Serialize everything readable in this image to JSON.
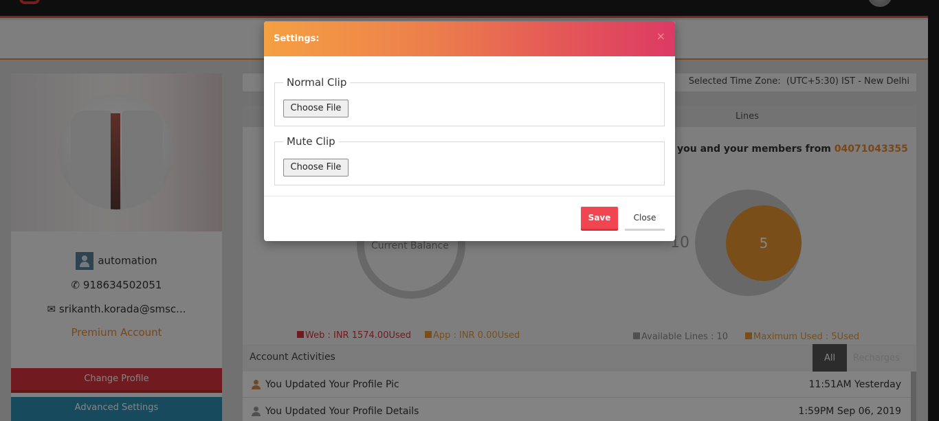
{
  "profile": {
    "username": "automation",
    "phone": "918634502051",
    "email": "srikanth.korada@smsc...",
    "account_type": "Premium Account",
    "change_profile_label": "Change Profile",
    "advanced_settings_label": "Advanced Settings"
  },
  "timezone": {
    "label": "Selected Time Zone:",
    "value": "(UTC+5:30) IST - New Delhi"
  },
  "dashboard": {
    "lines_header": "Lines",
    "members_text": "you and your members from",
    "members_number": "04071043355",
    "current_balance_label": "Current Balance",
    "lines_total": "10",
    "lines_used": "5",
    "legend_web": "Web : INR 1574.00Used",
    "legend_app": "App : INR 0.00Used",
    "legend_available": "Available Lines : 10",
    "legend_max": "Maximum Used : 5Used",
    "colors": {
      "web": "#d8333c",
      "app": "#e8962e",
      "available": "#999999",
      "max": "#e8962e"
    }
  },
  "activities": {
    "title": "Account Activities",
    "tab_all": "All",
    "tab_recharges": "Recharges",
    "rows": [
      {
        "text": "You Updated Your Profile Pic",
        "time": "11:51AM Yesterday"
      },
      {
        "text": "You Updated Your Profile Details",
        "time": "1:59PM Sep 06, 2019"
      }
    ]
  },
  "modal": {
    "title": "Settings:",
    "close_x": "×",
    "normal_clip_label": "Normal Clip",
    "mute_clip_label": "Mute Clip",
    "choose_file_label": "Choose File",
    "save_label": "Save",
    "close_label": "Close",
    "header_gradient": [
      "#f5a043",
      "#dc3a63"
    ],
    "save_color": "#f04652"
  }
}
